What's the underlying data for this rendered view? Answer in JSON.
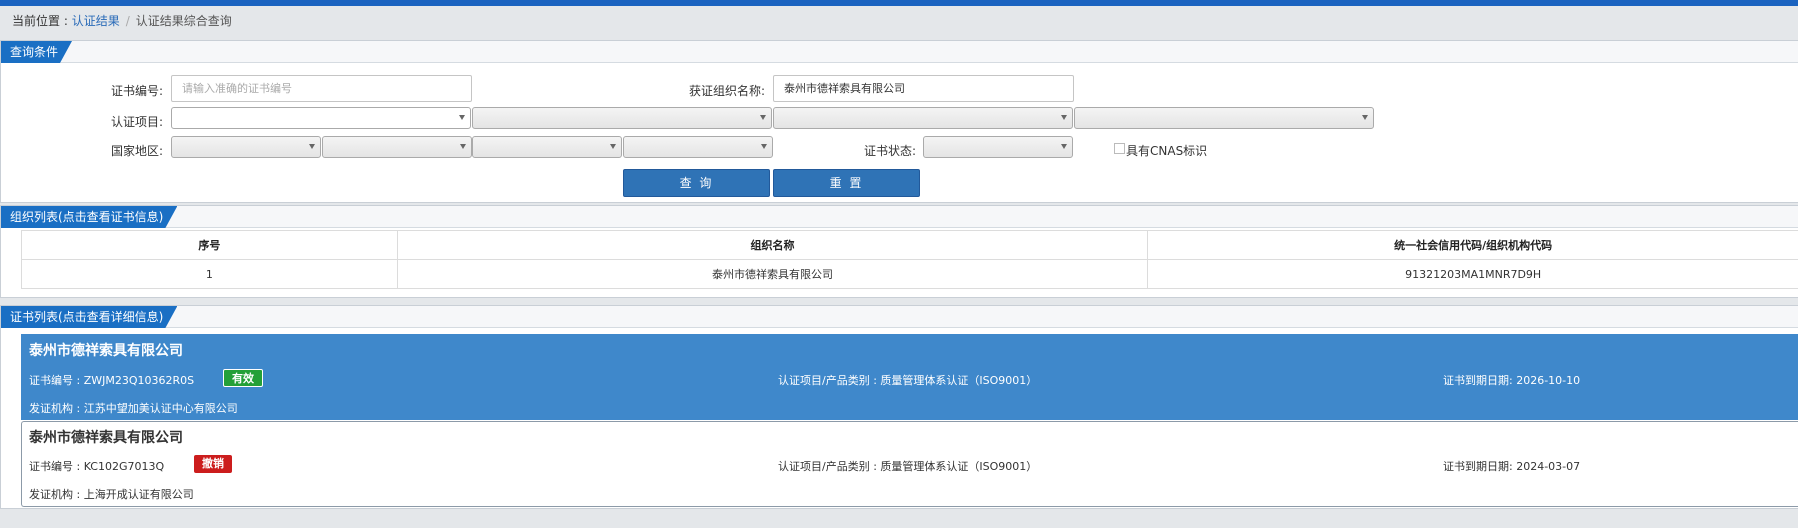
{
  "breadcrumb": {
    "prefix": "当前位置 : ",
    "link": "认证结果",
    "separator": "/",
    "current": "认证结果综合查询"
  },
  "query": {
    "title": "查询条件",
    "cert_no_label": "证书编号:",
    "cert_no_placeholder": "请输入准确的证书编号",
    "org_name_label": "获证组织名称:",
    "org_name_value": "泰州市德祥索具有限公司",
    "project_label": "认证项目:",
    "region_label": "国家地区:",
    "status_label": "证书状态:",
    "cnas_label": "具有CNAS标识",
    "search_label": "查 询",
    "reset_label": "重 置"
  },
  "org_list": {
    "title": "组织列表(点击查看证书信息)",
    "columns": [
      "序号",
      "组织名称",
      "统一社会信用代码/组织机构代码"
    ],
    "rows": [
      [
        "1",
        "泰州市德祥索具有限公司",
        "91321203MA1MNR7D9H"
      ]
    ]
  },
  "cert_list": {
    "title": "证书列表(点击查看详细信息)",
    "items": [
      {
        "org": "泰州市德祥索具有限公司",
        "cert_no": "证书编号 : ZWJM23Q10362R0S",
        "status": "有效",
        "project": "认证项目/产品类别 : 质量管理体系认证（ISO9001）",
        "expiry": "证书到期日期: 2026-10-10",
        "issuer": "发证机构 : 江苏中望加美认证中心有限公司"
      },
      {
        "org": "泰州市德祥索具有限公司",
        "cert_no": "证书编号 : KC102G7013Q",
        "status": "撤销",
        "project": "认证项目/产品类别 : 质量管理体系认证（ISO9001）",
        "expiry": "证书到期日期: 2024-03-07",
        "issuer": "发证机构 : 上海开成认证有限公司"
      }
    ]
  },
  "colors": {
    "accent": "#1a6fc4",
    "active_row": "#3f88cb",
    "valid": "#24a038",
    "revoked": "#cc1d1d"
  }
}
